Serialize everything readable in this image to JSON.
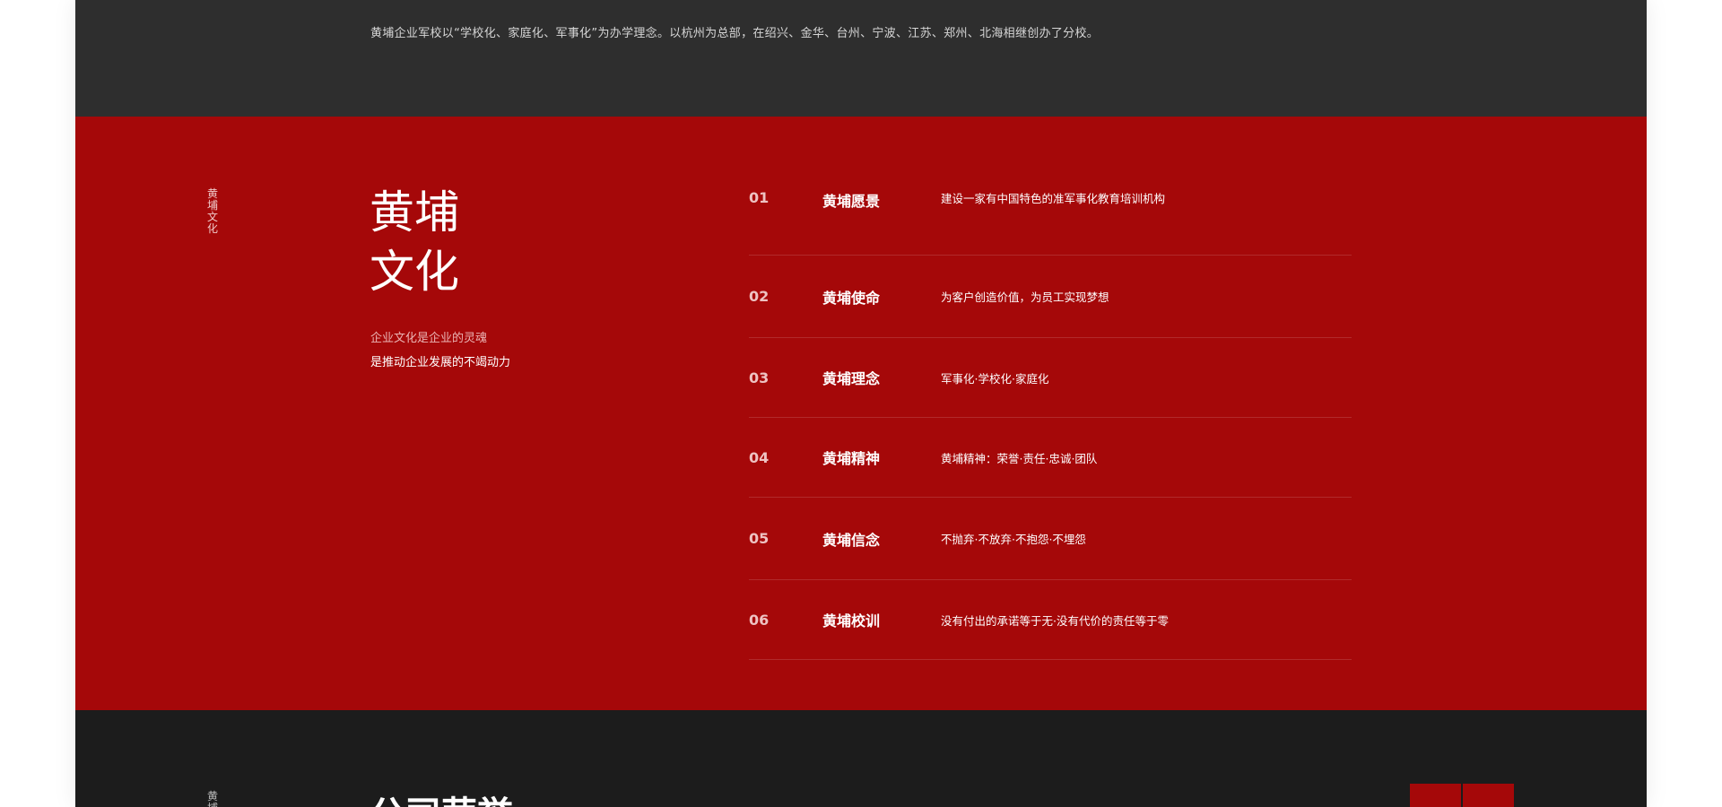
{
  "intro": {
    "text": "黄埔企业军校以“学校化、家庭化、军事化”为办学理念。以杭州为总部，在绍兴、金华、台州、宁波、江苏、郑州、北海相继创办了分校。"
  },
  "culture": {
    "side_label": "黄埔文化",
    "title": "黄埔文化",
    "subtitle_1": "企业文化是企业的灵魂",
    "subtitle_2": "是推动企业发展的不竭动力",
    "items": [
      {
        "num": "01",
        "name": "黄埔愿景",
        "desc": "建设一家有中国特色的准军事化教育培训机构"
      },
      {
        "num": "02",
        "name": "黄埔使命",
        "desc": "为客户创造价值，为员工实现梦想"
      },
      {
        "num": "03",
        "name": "黄埔理念",
        "desc": "军事化·学校化·家庭化"
      },
      {
        "num": "04",
        "name": "黄埔精神",
        "desc": "黄埔精神：荣誉·责任·忠诚·团队"
      },
      {
        "num": "05",
        "name": "黄埔信念",
        "desc": "不抛弃·不放弃·不抱怨·不埋怨"
      },
      {
        "num": "06",
        "name": "黄埔校训",
        "desc": "没有付出的承诺等于无·没有代价的责任等于零"
      }
    ]
  },
  "honor": {
    "side_label": "黄埔",
    "title": "公司荣誉"
  },
  "colors": {
    "brand_red": "#a50809",
    "dark_band": "#2e2e2e",
    "footer_band": "#1c1c1c"
  }
}
